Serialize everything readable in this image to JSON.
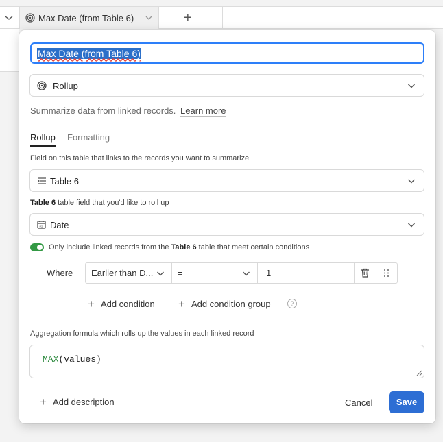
{
  "header": {
    "column_title": "Max Date (from Table 6)",
    "add_column_label": "+"
  },
  "dialog": {
    "field_name": "Max Date (from Table 6)",
    "field_type": "Rollup",
    "description": "Summarize data from linked records.",
    "learn_more": "Learn more",
    "tabs": [
      {
        "label": "Rollup",
        "active": true
      },
      {
        "label": "Formatting",
        "active": false
      }
    ],
    "link_field_label": "Field on this table that links to the records you want to summarize",
    "link_field_value": "Table 6",
    "rollup_field_label_table": "Table 6",
    "rollup_field_label_rest": " table field that you'd like to roll up",
    "rollup_field_value": "Date",
    "toggle_text_pre": "Only include linked records from the ",
    "toggle_text_table": "Table 6",
    "toggle_text_post": " table that meet certain conditions",
    "toggle_on": true,
    "condition": {
      "where_label": "Where",
      "field": "Earlier than D...",
      "operator": "=",
      "value": "1"
    },
    "add_condition": "Add condition",
    "add_condition_group": "Add condition group",
    "help_glyph": "?",
    "aggregation_label": "Aggregation formula which rolls up the values in each linked record",
    "formula_fn": "MAX",
    "formula_args": "(values)",
    "add_description": "Add description",
    "cancel": "Cancel",
    "save": "Save"
  },
  "colors": {
    "accent": "#2d7ff9",
    "save": "#2d6ed4",
    "toggle": "#339944",
    "formula_fn": "#2d8a3e"
  }
}
